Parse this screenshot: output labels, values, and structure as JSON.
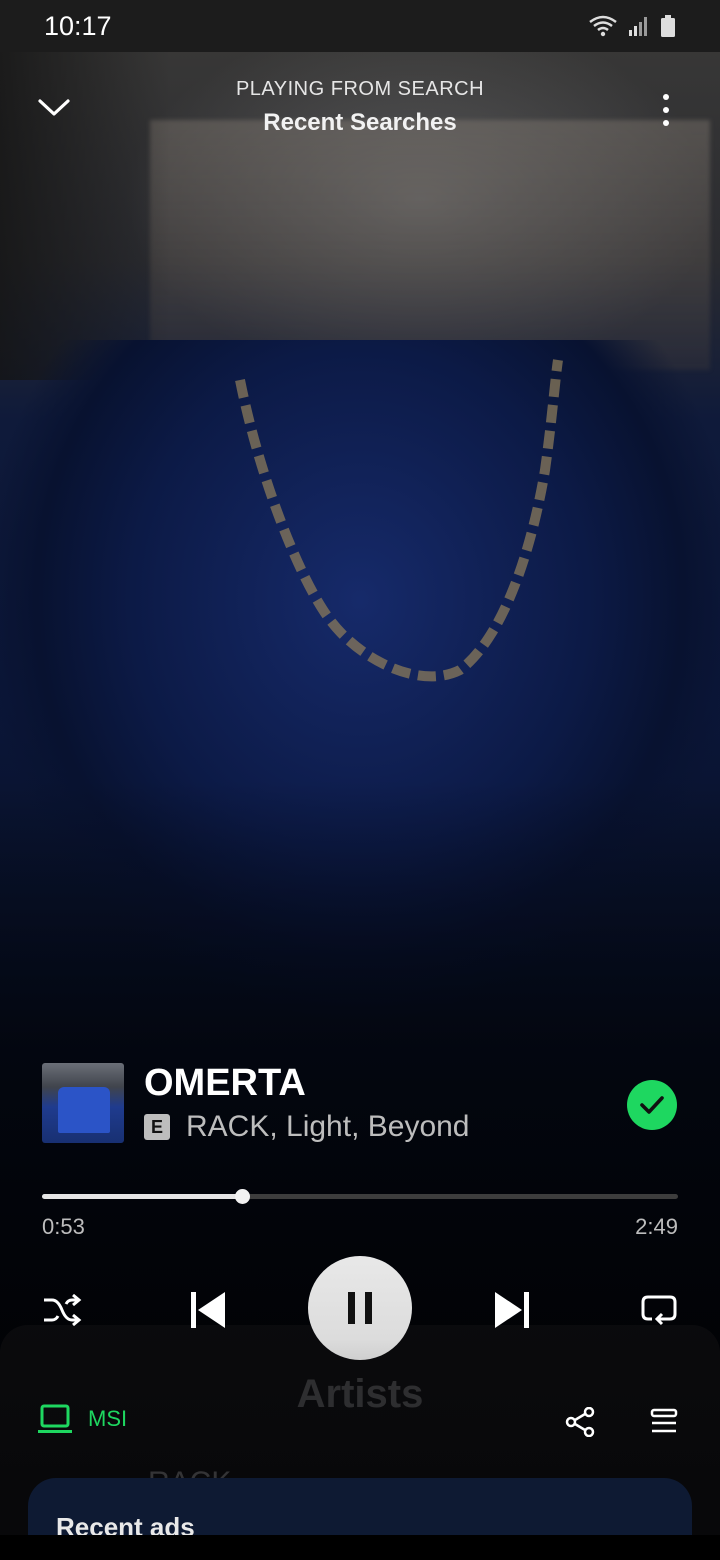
{
  "status_bar": {
    "time": "10:17",
    "icons": [
      "wifi-icon",
      "signal-icon",
      "battery-icon"
    ]
  },
  "header": {
    "context_label": "PLAYING FROM SEARCH",
    "context_name": "Recent Searches",
    "collapse_icon": "chevron-down-icon",
    "more_icon": "more-vertical-icon"
  },
  "track": {
    "title": "OMERTA",
    "explicit_badge": "E",
    "artists": "RACK, Light, Beyond",
    "liked": true
  },
  "playback": {
    "elapsed": "0:53",
    "duration": "2:49",
    "progress_fraction": 0.314,
    "is_playing": true
  },
  "device": {
    "name": "MSI",
    "icon": "laptop-icon"
  },
  "underlay": {
    "section_title": "Artists",
    "artist_name": "RACK",
    "recent_ads_title": "Recent ads"
  },
  "colors": {
    "accent_green": "#1ed760",
    "background_blue": "#0c1a46",
    "panel_navy": "#0e1a33"
  }
}
